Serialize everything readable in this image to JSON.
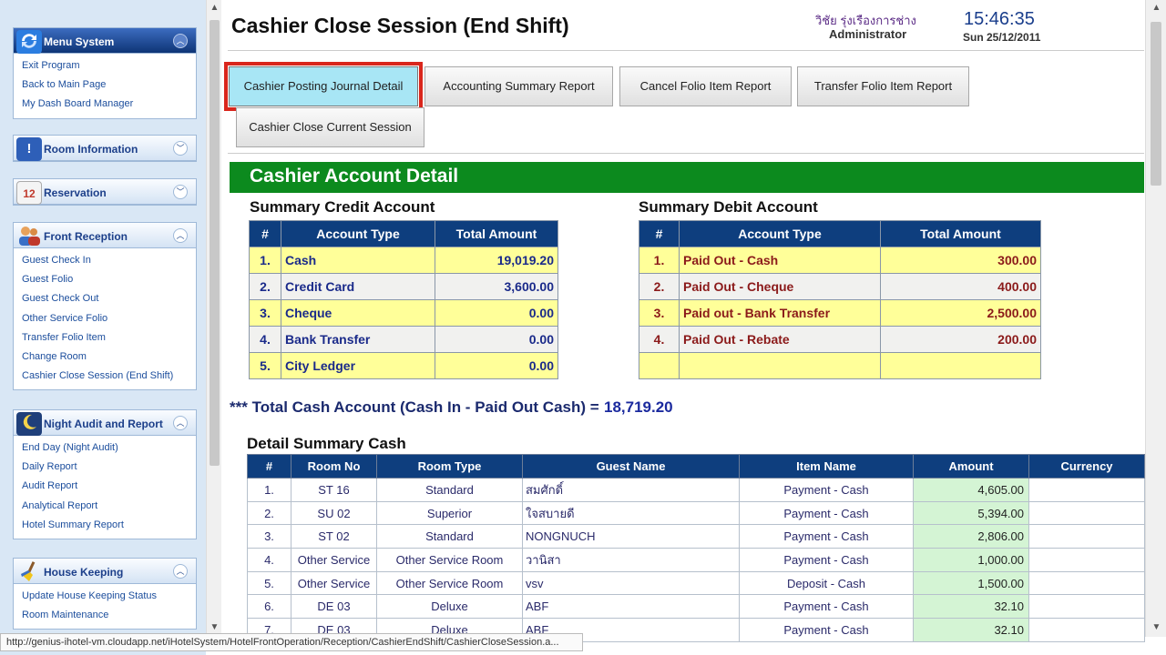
{
  "sidebar": {
    "panels": [
      {
        "title": "Menu System",
        "icon": "refresh-arrows-icon",
        "toggle": "⌃",
        "links": [
          "Exit Program",
          "Back to Main Page",
          "My Dash Board Manager"
        ]
      },
      {
        "title": "Room Information",
        "icon": "info-icon",
        "toggle": "⌄",
        "links": []
      },
      {
        "title": "Reservation",
        "icon": "calendar-icon",
        "toggle": "⌄",
        "links": []
      },
      {
        "title": "Front Reception",
        "icon": "people-icon",
        "toggle": "⌃",
        "links": [
          "Guest Check In",
          "Guest Folio",
          "Guest Check Out",
          "Other Service Folio",
          "Transfer Folio Item",
          "Change Room",
          "Cashier Close Session (End Shift)"
        ]
      },
      {
        "title": "Night Audit and Report",
        "icon": "moon-icon",
        "toggle": "⌃",
        "links": [
          "End Day (Night Audit)",
          "Daily Report",
          "Audit Report",
          "Analytical Report",
          "Hotel Summary Report"
        ]
      },
      {
        "title": "House Keeping",
        "icon": "broom-icon",
        "toggle": "⌃",
        "links": [
          "Update House Keeping Status",
          "Room Maintenance"
        ]
      }
    ]
  },
  "header": {
    "title": "Cashier Close Session (End Shift)",
    "user_name": "วิชัย รุ่งเรืองการช่าง",
    "user_role": "Administrator",
    "time": "15:46:35",
    "date": "Sun 25/12/2011"
  },
  "buttons": {
    "posting_journal": "Cashier Posting Journal Detail",
    "accounting_summary": "Accounting Summary Report",
    "cancel_folio": "Cancel Folio Item Report",
    "transfer_folio": "Transfer Folio Item Report",
    "close_session": "Cashier Close Current Session"
  },
  "section_title": "Cashier Account Detail",
  "credit": {
    "title": "Summary Credit Account",
    "headers": [
      "#",
      "Account Type",
      "Total Amount"
    ],
    "rows": [
      [
        "1.",
        "Cash",
        "19,019.20"
      ],
      [
        "2.",
        "Credit Card",
        "3,600.00"
      ],
      [
        "3.",
        "Cheque",
        "0.00"
      ],
      [
        "4.",
        "Bank Transfer",
        "0.00"
      ],
      [
        "5.",
        "City Ledger",
        "0.00"
      ]
    ]
  },
  "debit": {
    "title": "Summary Debit Account",
    "headers": [
      "#",
      "Account Type",
      "Total Amount"
    ],
    "rows": [
      [
        "1.",
        "Paid Out - Cash",
        "300.00"
      ],
      [
        "2.",
        "Paid Out - Cheque",
        "400.00"
      ],
      [
        "3.",
        "Paid out - Bank Transfer",
        "2,500.00"
      ],
      [
        "4.",
        "Paid Out - Rebate",
        "200.00"
      ],
      [
        "",
        "",
        ""
      ]
    ]
  },
  "total": {
    "label": "*** Total Cash Account (Cash In - Paid Out Cash) =",
    "value": "18,719.20"
  },
  "detail": {
    "title": "Detail Summary Cash",
    "headers": [
      "#",
      "Room No",
      "Room Type",
      "Guest Name",
      "Item Name",
      "Amount",
      "Currency"
    ],
    "rows": [
      [
        "1.",
        "ST 16",
        "Standard",
        "สมศักดิ์",
        "Payment - Cash",
        "4,605.00",
        ""
      ],
      [
        "2.",
        "SU 02",
        "Superior",
        "ใจสบายดี",
        "Payment - Cash",
        "5,394.00",
        ""
      ],
      [
        "3.",
        "ST 02",
        "Standard",
        "NONGNUCH",
        "Payment - Cash",
        "2,806.00",
        ""
      ],
      [
        "4.",
        "Other Service",
        "Other Service Room",
        "วานิสา",
        "Payment - Cash",
        "1,000.00",
        ""
      ],
      [
        "5.",
        "Other Service",
        "Other Service Room",
        "vsv",
        "Deposit - Cash",
        "1,500.00",
        ""
      ],
      [
        "6.",
        "DE 03",
        "Deluxe",
        "ABF",
        "Payment - Cash",
        "32.10",
        ""
      ],
      [
        "7.",
        "DE 03",
        "Deluxe",
        "ABF",
        "Payment - Cash",
        "32.10",
        ""
      ]
    ]
  },
  "status_url": "http://genius-ihotel-vm.cloudapp.net/iHotelSystem/HotelFrontOperation/Reception/CashierEndShift/CashierCloseSession.a...",
  "colors": {
    "section_green": "#0c8a1e",
    "header_navy": "#0e3e7e",
    "row_yellow": "#ffff99",
    "amount_green": "#d4f4d4",
    "active_outline_red": "#d9261c"
  }
}
